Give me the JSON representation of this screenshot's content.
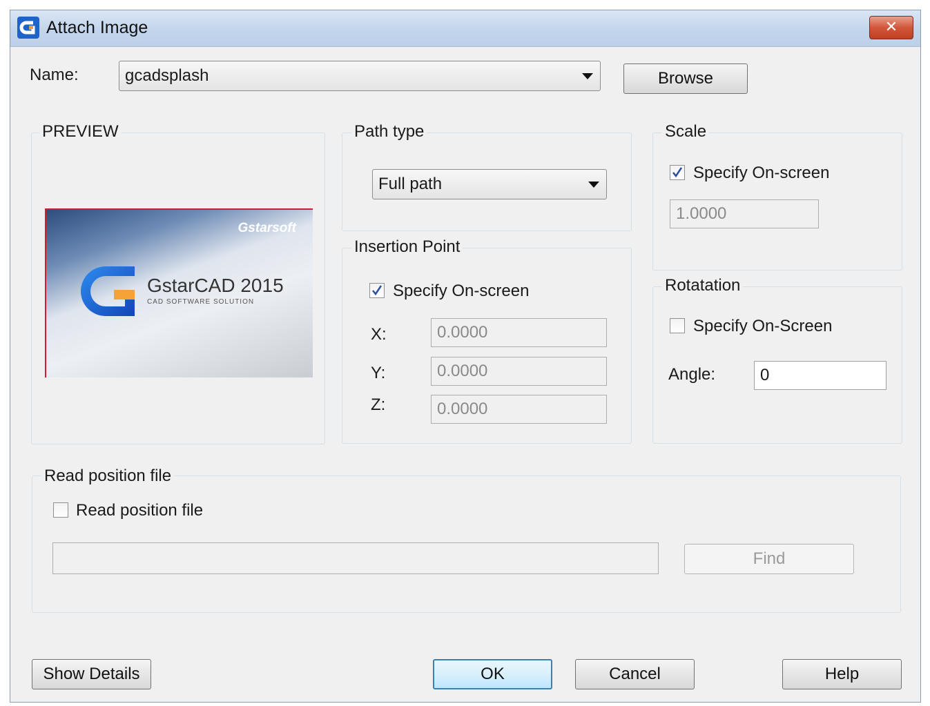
{
  "window": {
    "title": "Attach Image",
    "close_symbol": "✕"
  },
  "name_field": {
    "label": "Name:",
    "value": "gcadsplash"
  },
  "browse_button": "Browse",
  "preview": {
    "title": "PREVIEW",
    "brand_logo": "Gstarsoft",
    "product_name": "GstarCAD 2015",
    "product_tagline": "CAD SOFTWARE SOLUTION"
  },
  "path_type": {
    "title": "Path type",
    "selected": "Full path"
  },
  "insertion_point": {
    "title": "Insertion Point",
    "specify_label": "Specify On-screen",
    "specify_checked": true,
    "x_label": "X:",
    "x_value": "0.0000",
    "y_label": "Y:",
    "y_value": "0.0000",
    "z_label": "Z:",
    "z_value": "0.0000"
  },
  "scale": {
    "title": "Scale",
    "specify_label": "Specify On-screen",
    "specify_checked": true,
    "value": "1.0000"
  },
  "rotation": {
    "title": "Rotatation",
    "specify_label": "Specify On-Screen",
    "specify_checked": false,
    "angle_label": "Angle:",
    "angle_value": "0"
  },
  "read_position": {
    "title": "Read position file",
    "checkbox_label": "Read position file",
    "checked": false,
    "path_value": "",
    "find_button": "Find"
  },
  "footer": {
    "show_details": "Show Details",
    "ok": "OK",
    "cancel": "Cancel",
    "help": "Help"
  },
  "colors": {
    "titlebar": "#c3d5ec",
    "close_button": "#d2573c",
    "dialog_bg": "#f0f0f0",
    "default_button_border": "#3c7fb1"
  },
  "icons": [
    "app-icon",
    "close-icon",
    "dropdown-arrow-icon",
    "checkmark-icon"
  ]
}
